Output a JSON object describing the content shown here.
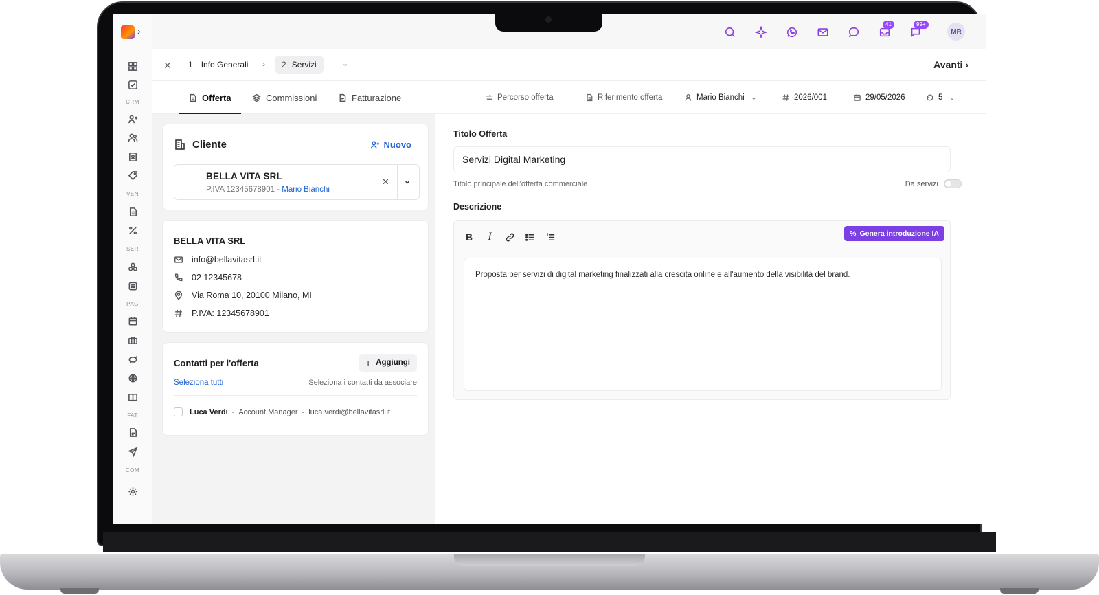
{
  "topbar": {
    "icons": [
      "search-icon",
      "sparkle-icon",
      "whatsapp-icon",
      "mail-icon",
      "chat-icon",
      "inbox-icon",
      "notifications-icon"
    ],
    "badge_inbox": "41",
    "badge_notifications": "99+",
    "avatar_initials": "MR"
  },
  "sidebar": {
    "sections": [
      "CRM",
      "VEN",
      "SER",
      "PAG",
      "FAT",
      "COM"
    ]
  },
  "stepper": {
    "step1_num": "1",
    "step1_label": "Info Generali",
    "step2_num": "2",
    "step2_label": "Servizi",
    "next_label": "Avanti"
  },
  "tabs": [
    "Offerta",
    "Commissioni",
    "Fatturazione"
  ],
  "meta": {
    "percorso": "Percorso offerta",
    "riferimento": "Riferimento offerta",
    "owner": "Mario Bianchi",
    "number": "2026/001",
    "date": "29/05/2026",
    "revisions": "5"
  },
  "cliente": {
    "title": "Cliente",
    "new_label": "Nuovo",
    "name": "BELLA VITA SRL",
    "piva_line": "P.IVA 12345678901",
    "dash": "-",
    "owner": "Mario Bianchi"
  },
  "details": {
    "name": "BELLA VITA SRL",
    "email": "info@bellavitasrl.it",
    "phone": "02 12345678",
    "address": "Via Roma 10, 20100 Milano, MI",
    "piva": "P.IVA: 12345678901"
  },
  "contatti": {
    "title": "Contatti per l'offerta",
    "add_label": "Aggiungi",
    "select_all": "Seleziona tutti",
    "hint": "Seleziona i contatti da associare",
    "contact_name": "Luca Verdi",
    "contact_role": "Account Manager",
    "contact_email": "luca.verdi@bellavitasrl.it",
    "sep": "-"
  },
  "form": {
    "title_label": "Titolo Offerta",
    "title_value": "Servizi Digital Marketing",
    "title_hint": "Titolo principale dell'offerta commerciale",
    "toggle_label": "Da servizi",
    "desc_label": "Descrizione",
    "ai_label": "Genera introduzione IA",
    "description": "Proposta per servizi di digital marketing finalizzati alla crescita online e all'aumento della visibilità del brand."
  }
}
